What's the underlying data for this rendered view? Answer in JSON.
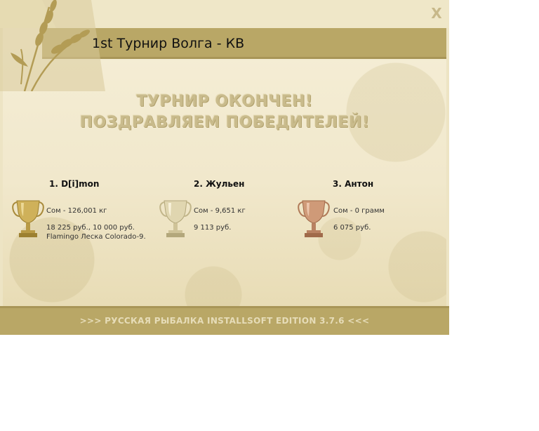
{
  "window": {
    "title": "1st Турнир Волга - КВ",
    "close_label": "X"
  },
  "headline": {
    "line1": "ТУРНИР ОКОНЧЕН!",
    "line2": "ПОЗДРАВЛЯЕМ ПОБЕДИТЕЛЕЙ!"
  },
  "winners": [
    {
      "name": "1. D[i]mon",
      "catch": "Сом - 126,001 кг",
      "prize": "18 225 руб., 10 000 руб.",
      "items": "Flamingo Леска Colorado-9.",
      "trophy": "gold-trophy-icon"
    },
    {
      "name": "2. Жульен",
      "catch": "Сом - 9,651 кг",
      "prize": "9 113 руб.",
      "items": "",
      "trophy": "silver-trophy-icon"
    },
    {
      "name": "3. Антон",
      "catch": "Сом - 0 грамм",
      "prize": "6 075 руб.",
      "items": "",
      "trophy": "bronze-trophy-icon"
    }
  ],
  "footer": {
    "text": ">>> РУССКАЯ РЫБАЛКА INSTALLSOFT EDITION 3.7.6 <<<"
  },
  "colors": {
    "band": "#b9a766",
    "panel": "#f1e8cc",
    "gold": "#c9a94a",
    "silver": "#d8cfae",
    "bronze": "#c98e6a"
  }
}
